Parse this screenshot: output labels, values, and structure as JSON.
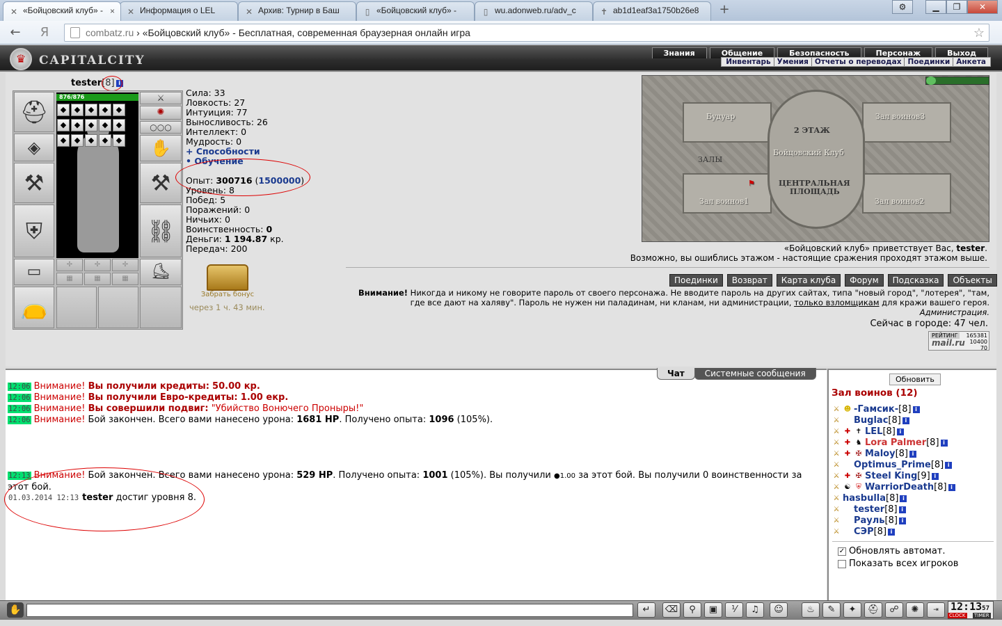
{
  "browser": {
    "tabs": [
      {
        "title": "«Бойцовский клуб» -",
        "active": true
      },
      {
        "title": "Информация о LEL",
        "active": false
      },
      {
        "title": "Архив: Турнир в Баш",
        "active": false
      },
      {
        "title": "«Бойцовский клуб» -",
        "active": false
      },
      {
        "title": "wu.adonweb.ru/adv_c",
        "active": false
      },
      {
        "title": "ab1d1eaf3a1750b26e8",
        "active": false
      }
    ],
    "new_tab": "+",
    "url_domain": "combatz.ru",
    "url_title": " › «Бойцовский клуб» - Бесплатная, современная браузерная онлайн игра",
    "yandex_glyph": "Я"
  },
  "game": {
    "logo": "CAPITALCITY",
    "menu": [
      "Знания",
      "Общение",
      "Безопасность",
      "Персонаж",
      "Выход"
    ],
    "submenu": [
      "Инвентарь",
      "Умения",
      "Отчеты о переводах",
      "Поединки",
      "Анкета"
    ]
  },
  "character": {
    "name": "tester",
    "level": "[8]",
    "hp": "876/876",
    "hp_fraction": 1.0
  },
  "stats": {
    "strength": "Сила: 33",
    "agility": "Ловкость: 27",
    "intuition": "Интуиция: 77",
    "endurance": "Выносливость: 26",
    "intellect": "Интеллект: 0",
    "wisdom": "Мудрость: 0",
    "abilities": "+ Способности",
    "training": "• Обучение",
    "exp_label": "Опыт: ",
    "exp_value": "300716",
    "exp_next": "1500000",
    "level_line": "Уровень: 8",
    "wins": "Побед: 5",
    "losses": "Поражений: 0",
    "draws": "Ничьих: 0",
    "valor_label": "Воинственность: ",
    "valor_value": "0",
    "money_label": "Деньги: ",
    "money_value": "1 194.87",
    "money_unit": " кр.",
    "transfers": "Передач: 200"
  },
  "bonus": {
    "label": "Забрать бонус",
    "timer": "через 1 ч. 43 мин."
  },
  "map": {
    "rooms": [
      "Будуар",
      "Зал воинов3",
      "Зал воинов1",
      "Зал воинов2"
    ],
    "floor": "2 ЭТАЖ",
    "club": "Бойцовский Клуб",
    "halls": "ЗАЛЫ",
    "square_line1": "ЦЕНТРАЛЬНАЯ",
    "square_line2": "ПЛОЩАДЬ"
  },
  "greeting": {
    "line1_prefix": "«Бойцовский клуб» приветствует Вас, ",
    "line1_name": "tester",
    "line2": "Возможно, вы ошиблись этажом - настоящие сражения проходят этажом выше."
  },
  "actions": [
    "Поединки",
    "Возврат",
    "Карта клуба",
    "Форум",
    "Подсказка",
    "Объекты"
  ],
  "warning": {
    "title": "Внимание!",
    "text": " Никогда и никому не говорите пароль от своего персонажа. Не вводите пароль на других сайтах, типа \"новый город\", \"лотерея\", \"там, где все дают на халяву\". Пароль не нужен ни паладинам, ни кланам, ни администрации, ",
    "link": "только взломщикам",
    "tail": " для кражи вашего героя.",
    "admin": "Администрация."
  },
  "online": "Сейчас в городе: 47 чел.",
  "counter": {
    "rating": "РЕЙТИНГ",
    "n1": "165381",
    "n2": "10400",
    "n3": "70",
    "brand": "mail.ru"
  },
  "chat": {
    "tabs": [
      "Чат",
      "Системные сообщения"
    ],
    "messages": [
      {
        "ts": "12:06",
        "warn": "Внимание!",
        "bold": "Вы получили кредиты:",
        "rest": "50.00 кр."
      },
      {
        "ts": "12:06",
        "warn": "Внимание!",
        "bold": "Вы получили Евро-кредиты:",
        "rest": "1.00 екр."
      },
      {
        "ts": "12:06",
        "warn": "Внимание!",
        "bold": "Вы совершили подвиг:",
        "rest": "\"Убийство Вонючего Проныры!\""
      },
      {
        "ts": "12:06",
        "warn": "Внимание!",
        "text": " Бой закончен. Всего вами нанесено урона: ",
        "b1": "1681 HP",
        "t2": ". Получено опыта: ",
        "b2": "1096",
        "t3": " (105%)."
      },
      {
        "ts": "12:13",
        "warn": "Внимание!",
        "text": " Бой закончен. Всего вами нанесено урона: ",
        "b1": "529 HP",
        "t2": ". Получено опыта: ",
        "b2": "1001",
        "t3": " (105%). Вы получили ",
        "t4": "1.00",
        "t5": " за этот бой. Вы получили 0 воинственности за этот бой."
      },
      {
        "ts": "01.03.2014 12:13",
        "name": "tester",
        "text": " достиг уровня 8."
      }
    ]
  },
  "room": {
    "refresh": "Обновить",
    "title": "Зал воинов (12)",
    "players": [
      {
        "name": "-Гамсик-",
        "level": "[8]"
      },
      {
        "name": "Buglac",
        "level": "[8]"
      },
      {
        "name": "LEL",
        "level": "[8]"
      },
      {
        "name": "Lora Palmer",
        "level": "[8]"
      },
      {
        "name": "Maloy",
        "level": "[8]"
      },
      {
        "name": "Optimus_Prime",
        "level": "[8]"
      },
      {
        "name": "Steel King",
        "level": "[9]"
      },
      {
        "name": "WarriorDeath",
        "level": "[8]"
      },
      {
        "name": "hasbulla",
        "level": "[8]"
      },
      {
        "name": "tester",
        "level": "[8]"
      },
      {
        "name": "Рауль",
        "level": "[8]"
      },
      {
        "name": "СЭР",
        "level": "[8]"
      }
    ],
    "auto_refresh": "Обновлять автомат.",
    "auto_refresh_checked": true,
    "show_all": "Показать всех игроков",
    "show_all_checked": false
  },
  "clock": {
    "time": "12:13",
    "sec": "57",
    "label": "CLOCK",
    "timer": "TIMER"
  }
}
